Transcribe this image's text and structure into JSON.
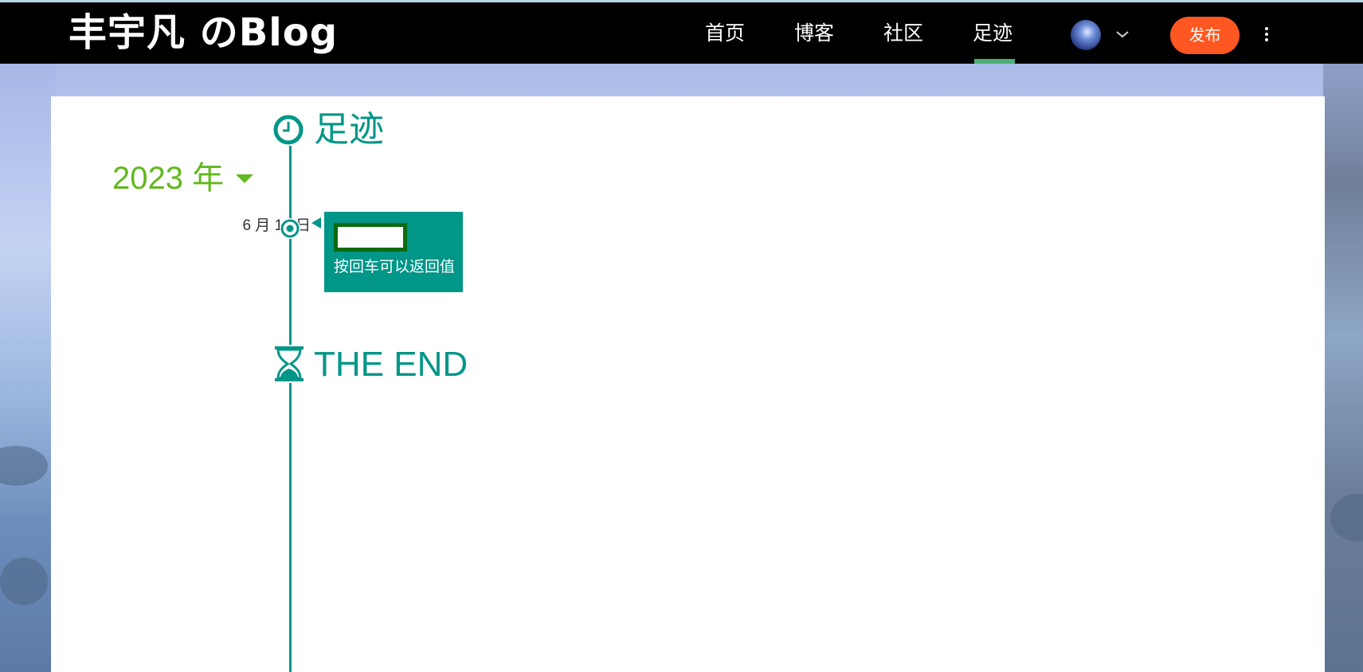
{
  "header": {
    "brand": "丰宇凡 のBlog",
    "nav": [
      {
        "label": "首页",
        "active": false
      },
      {
        "label": "博客",
        "active": false
      },
      {
        "label": "社区",
        "active": false
      },
      {
        "label": "足迹",
        "active": true
      }
    ],
    "publish_label": "发布",
    "icons": {
      "avatar": "avatar",
      "dropdown": "chevron-down-icon",
      "more": "more-vertical-icon"
    }
  },
  "timeline": {
    "title": "足迹",
    "title_icon": "clock-icon",
    "year": "2023 年",
    "year_icon": "caret-down-icon",
    "entries": [
      {
        "date": "6 月 19 日",
        "input_value": "",
        "text": "按回车可以返回值"
      }
    ],
    "end_label": "THE END",
    "end_icon": "hourglass-icon"
  },
  "colors": {
    "accent": "#009688",
    "year": "#62b81f",
    "publish": "#ff5722",
    "nav_active_underline": "#4caf73",
    "input_border": "#0b6b11"
  }
}
